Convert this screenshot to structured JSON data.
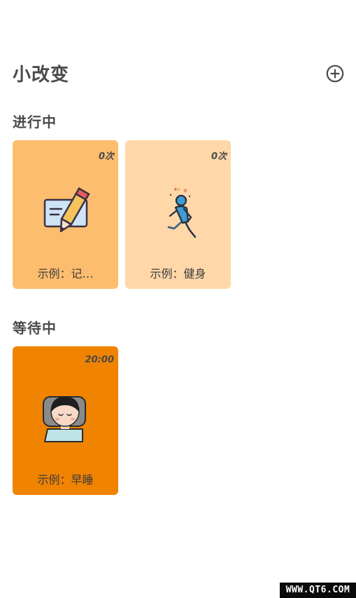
{
  "header": {
    "title": "小改变",
    "add_icon": "plus-circle-icon"
  },
  "sections": {
    "in_progress": {
      "title": "进行中",
      "cards": [
        {
          "label": "示例：记…",
          "badge": "0次",
          "icon": "notebook-pencil-icon",
          "color": "#FDBD6E"
        },
        {
          "label": "示例：健身",
          "badge": "0次",
          "icon": "running-person-icon",
          "color": "#FFD7A9"
        }
      ]
    },
    "waiting": {
      "title": "等待中",
      "cards": [
        {
          "label": "示例：早睡",
          "badge": "20:00",
          "icon": "sleeping-person-icon",
          "color": "#F08300"
        }
      ]
    }
  },
  "watermark": "WWW.QT6.COM"
}
